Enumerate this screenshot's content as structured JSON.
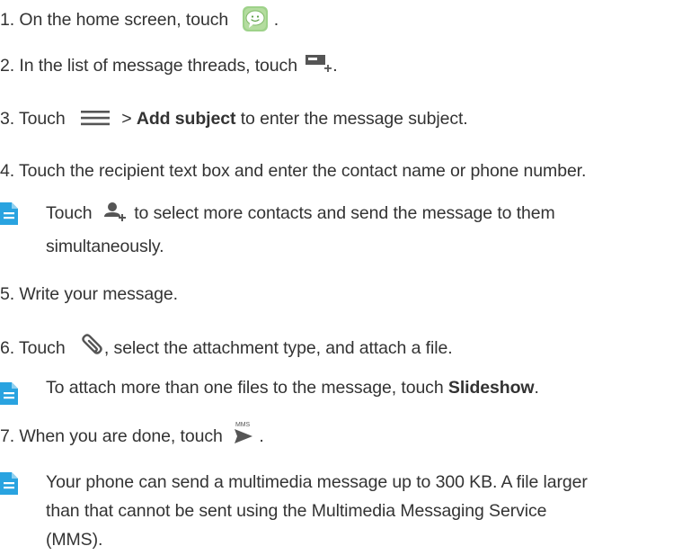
{
  "steps": {
    "s1": {
      "pre": "1. On the home screen, touch",
      "post": "."
    },
    "s2": {
      "pre": "2. In the list of message threads, touch",
      "post": "."
    },
    "s3": {
      "pre": "3. Touch",
      "mid": ">",
      "bold": "Add subject",
      "post": "to enter the message subject."
    },
    "s4": {
      "text": "4. Touch the recipient text box and enter the contact name or phone number."
    },
    "s5": {
      "text": "5. Write your message."
    },
    "s6": {
      "pre": "6. Touch",
      "post": ", select the attachment type, and attach a file."
    },
    "s7": {
      "pre": "7. When you are done, touch",
      "post": "."
    }
  },
  "notes": {
    "n1": {
      "pre": "Touch",
      "post": "to select more contacts and send the message to them",
      "line2": "simultaneously."
    },
    "n2": {
      "pre": "To attach more than one files to the message, touch",
      "bold": "Slideshow",
      "post": "."
    },
    "n3": {
      "line1": "Your phone can send a multimedia message up to 300 KB. A file larger",
      "line2": "than that cannot be sent using the Multimedia Messaging Service",
      "line3": "(MMS)."
    }
  },
  "icons": {
    "messaging_badge_label": "",
    "send_badge_label": "MMS"
  },
  "colors": {
    "text": "#333333",
    "note_blue": "#29a3e0",
    "icon_gray": "#555555",
    "messaging_green": "#9ed28a"
  }
}
